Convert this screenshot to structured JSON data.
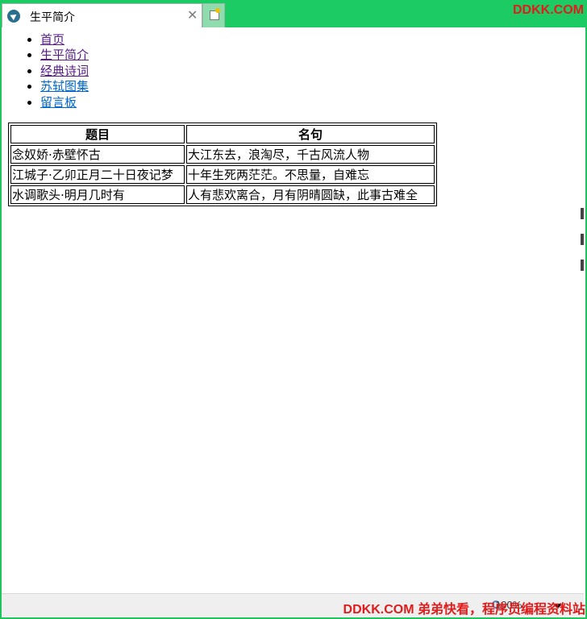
{
  "browser": {
    "tab_title": "生平简介",
    "watermark_top": "DDKK.COM",
    "watermark_bottom": "DDKK.COM 弟弟快看，程序员编程资料站",
    "zoom": "100%",
    "accent_color": "#1ccb63"
  },
  "nav": {
    "items": [
      {
        "label": "首页"
      },
      {
        "label": "生平简介"
      },
      {
        "label": "经典诗词"
      },
      {
        "label": "苏轼图集"
      },
      {
        "label": "留言板"
      }
    ]
  },
  "table": {
    "headers": [
      "题目",
      "名句"
    ],
    "rows": [
      [
        "念奴娇·赤壁怀古",
        "大江东去，浪淘尽，千古风流人物"
      ],
      [
        "江城子·乙卯正月二十日夜记梦",
        "十年生死两茫茫。不思量，自难忘"
      ],
      [
        "水调歌头·明月几时有",
        "人有悲欢离合，月有阴晴圆缺，此事古难全"
      ]
    ]
  }
}
